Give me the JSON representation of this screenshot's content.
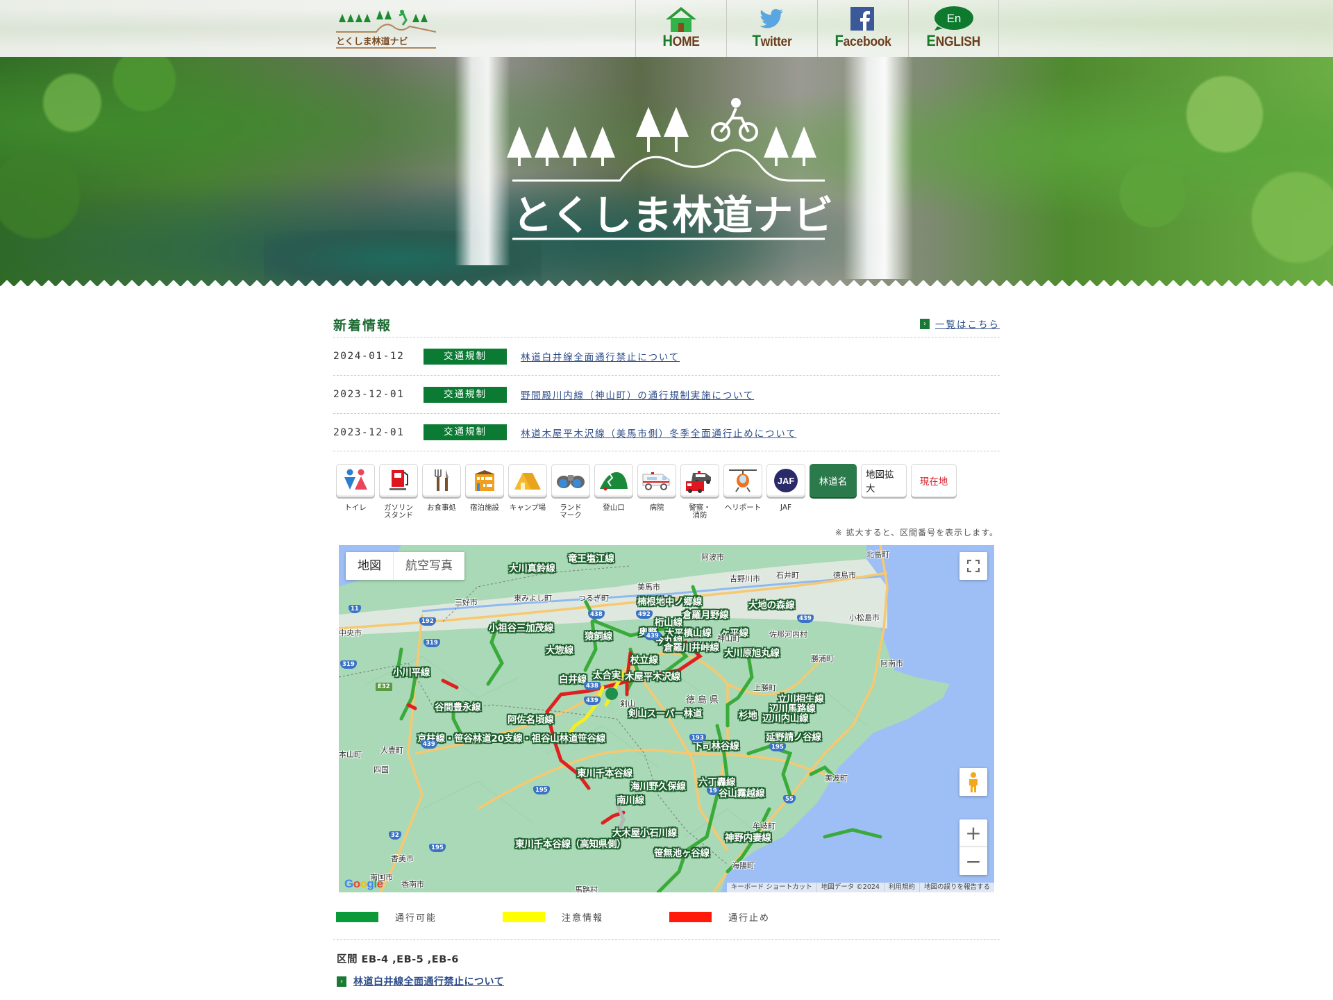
{
  "header": {
    "logo_text": "とくしま林道ナビ",
    "nav": [
      {
        "label": "HOME",
        "icon": "home-icon"
      },
      {
        "label": "Twitter",
        "icon": "twitter-icon"
      },
      {
        "label": "Facebook",
        "icon": "facebook-icon"
      },
      {
        "label": "ENGLISH",
        "icon": "english-en-icon",
        "badge": "En"
      }
    ]
  },
  "hero": {
    "title": "とくしま林道ナビ"
  },
  "news": {
    "title": "新着情報",
    "more_link": "一覧はこちら",
    "items": [
      {
        "date": "2024-01-12",
        "category": "交通規制",
        "title": "林道白井線全面通行禁止について"
      },
      {
        "date": "2023-12-01",
        "category": "交通規制",
        "title": "野間殿川内線（神山町）の通行規制実施について"
      },
      {
        "date": "2023-12-01",
        "category": "交通規制",
        "title": "林道木屋平木沢線（美馬市側）冬季全面通行止めについて"
      }
    ]
  },
  "facility_filters": [
    {
      "label": "トイレ",
      "icon": "toilet-icon"
    },
    {
      "label": "ガソリン\nスタンド",
      "icon": "gas-station-icon"
    },
    {
      "label": "お食事処",
      "icon": "restaurant-icon"
    },
    {
      "label": "宿泊施設",
      "icon": "lodging-icon"
    },
    {
      "label": "キャンプ場",
      "icon": "campsite-icon"
    },
    {
      "label": "ランド\nマーク",
      "icon": "binoculars-icon"
    },
    {
      "label": "登山口",
      "icon": "trailhead-icon"
    },
    {
      "label": "病院",
      "icon": "ambulance-icon"
    },
    {
      "label": "警察・\n消防",
      "icon": "police-fire-icon"
    },
    {
      "label": "ヘリポート",
      "icon": "helicopter-icon"
    },
    {
      "label": "JAF",
      "icon": "jaf-icon",
      "badge": "JAF"
    }
  ],
  "map_buttons": {
    "road_names": "林道名",
    "expand_map": "地図拡大",
    "current_location": "現在地"
  },
  "map_note": "※ 拡大すると、区間番号を表示します。",
  "map": {
    "type_map": "地図",
    "type_satellite": "航空写真",
    "footer": [
      "キーボード ショートカット",
      "地図データ ©2024",
      "利用規約",
      "地図の誤りを報告する"
    ],
    "google": "Google",
    "prefecture_label": "徳島県",
    "road_labels": [
      "竜王塩江線",
      "大川真鈴線",
      "楠根地中ノ郷線",
      "倉羅月野線",
      "大地の森線",
      "桁山線",
      "奥野",
      "大平槙山線",
      "ヶ平線",
      "今丸線",
      "倉羅川井峠線",
      "小祖谷三加茂線",
      "猿飼線",
      "大惣線",
      "杖立線",
      "大川原旭丸線",
      "小川平線",
      "白井線",
      "太合実",
      "木屋平木沢線",
      "谷間豊永線",
      "剣山スーパー林道",
      "阿佐名頃線",
      "京柱線・笹谷林道20支線・祖谷山林道笹谷線",
      "立川相生線",
      "辺川馬路線",
      "杉地",
      "辺川内山線",
      "延野請ノ谷線",
      "下司林谷線",
      "東川千本谷線",
      "海川野久保線",
      "六丁轟線",
      "谷山霧越線",
      "南川線",
      "大木屋小石川線",
      "東川千本谷線（高知県側）",
      "神野内妻線",
      "笹無池ヶ谷線"
    ],
    "place_labels": [
      "阿波市",
      "北島町",
      "吉野川市",
      "石井町",
      "徳島市",
      "美馬市",
      "三好市",
      "東みよし町",
      "つるぎ町",
      "小松島市",
      "佐那河内村",
      "神山町",
      "勝浦町",
      "阿南市",
      "上勝町",
      "中央市",
      "本山町",
      "大豊町",
      "四国",
      "美波町",
      "牟岐町",
      "海陽町",
      "香美市",
      "南国市",
      "香南市",
      "馬路村",
      "剣山"
    ],
    "route_shields": [
      "11",
      "192",
      "319",
      "319",
      "438",
      "492",
      "439",
      "439",
      "438",
      "439",
      "E32",
      "439",
      "195",
      "193",
      "195",
      "19",
      "55",
      "32",
      "195"
    ]
  },
  "legend": [
    {
      "label": "通行可能",
      "color": "#0a9a3a"
    },
    {
      "label": "注意情報",
      "color": "#ffff00"
    },
    {
      "label": "通行止め",
      "color": "#ff1a0a"
    }
  ],
  "section": {
    "label": "区間 EB-4 ,EB-5 ,EB-6",
    "link": "林道白井線全面通行禁止について"
  }
}
